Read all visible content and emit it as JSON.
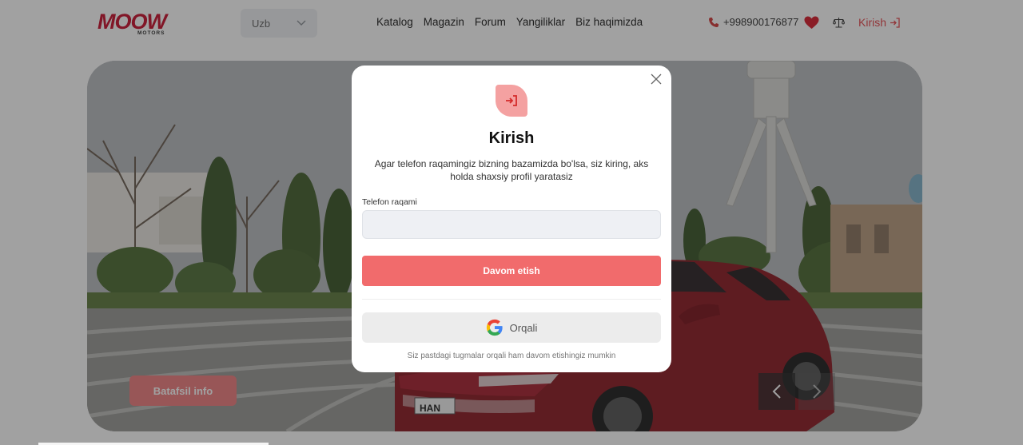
{
  "header": {
    "logo_text": "MOOW",
    "logo_sub": "MOTORS",
    "language": "Uzb",
    "nav": [
      "Katalog",
      "Magazin",
      "Forum",
      "Yangiliklar",
      "Biz haqimizda"
    ],
    "phone": "+998900176877",
    "login_label": "Kirish"
  },
  "hero": {
    "details_label": "Batafsil info",
    "plate_text": "HAN"
  },
  "modal": {
    "title": "Kirish",
    "description": "Agar telefon raqamingiz bizning bazamizda bo'lsa, siz kiring, aks holda shaxsiy profil yaratasiz",
    "phone_label": "Telefon raqami",
    "phone_value": "",
    "continue_label": "Davom etish",
    "google_label": "Orqali",
    "hint": "Siz pastdagi tugmalar orqali ham davom etishingiz mumkin"
  },
  "colors": {
    "brand": "#c8102e",
    "accent": "#f16b6c",
    "heart": "#d71d2b"
  },
  "icons": [
    "chevron-down-icon",
    "phone-icon",
    "heart-icon",
    "compare-scale-icon",
    "login-icon",
    "close-icon",
    "login-badge-icon",
    "google-icon",
    "arrow-left-icon",
    "arrow-right-icon"
  ]
}
